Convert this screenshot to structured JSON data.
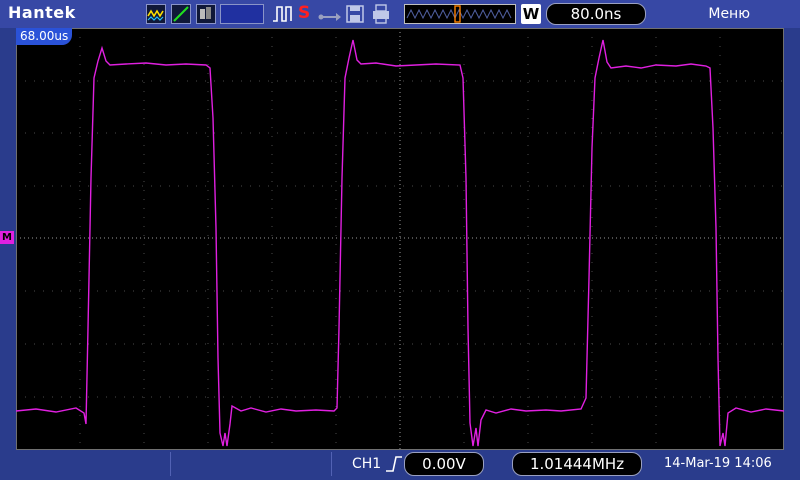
{
  "header": {
    "brand": "Hantek",
    "timebase": "80.0ns",
    "menu_label": "Меню",
    "zoom_mode": "W"
  },
  "screen": {
    "time_offset": "68.00us",
    "level_marker": "M"
  },
  "footer": {
    "channel": "CH1",
    "trigger_level": "0.00V",
    "frequency": "1.01444MHz",
    "datetime": "14-Mar-19 14:06"
  },
  "icons": {
    "trigger_edge": "rising-edge-icon",
    "acquire_status": "S",
    "usb": "usb-icon",
    "save": "save-icon",
    "print": "print-icon"
  },
  "colors": {
    "trace": "#e020e0",
    "background": "#2a3c8c",
    "screen": "#000000",
    "marker": "#2a52d8"
  }
}
